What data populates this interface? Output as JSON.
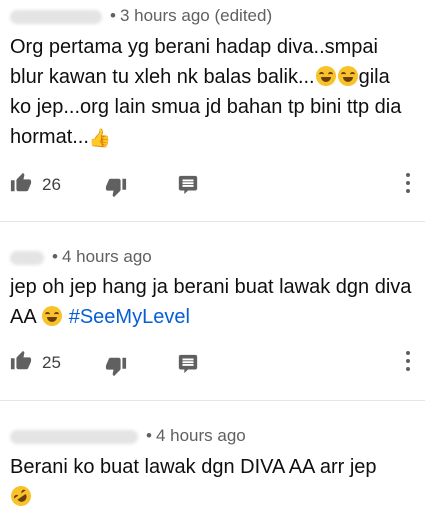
{
  "comments": [
    {
      "time": "3 hours ago (edited)",
      "text_1": "Org pertama yg berani hadap diva..smpai blur kawan tu xleh nk balas balik...",
      "emoji_1": "laughing-with-tears",
      "text_2": "gila ko jep...org lain smua jd bahan tp bini ttp dia hormat...",
      "emoji_2": "thumbs-up",
      "likes": "26"
    },
    {
      "time": "4 hours ago",
      "text_1": "jep oh jep hang ja berani buat lawak dgn diva AA ",
      "emoji_1": "laughing-with-tears",
      "hashtag": "#SeeMyLevel",
      "likes": "25"
    },
    {
      "time": "4 hours ago",
      "text_1": "Berani ko buat lawak dgn DIVA AA arr jep",
      "emoji_1": "rolling-on-floor-laughing"
    }
  ],
  "meta_separator": "•"
}
